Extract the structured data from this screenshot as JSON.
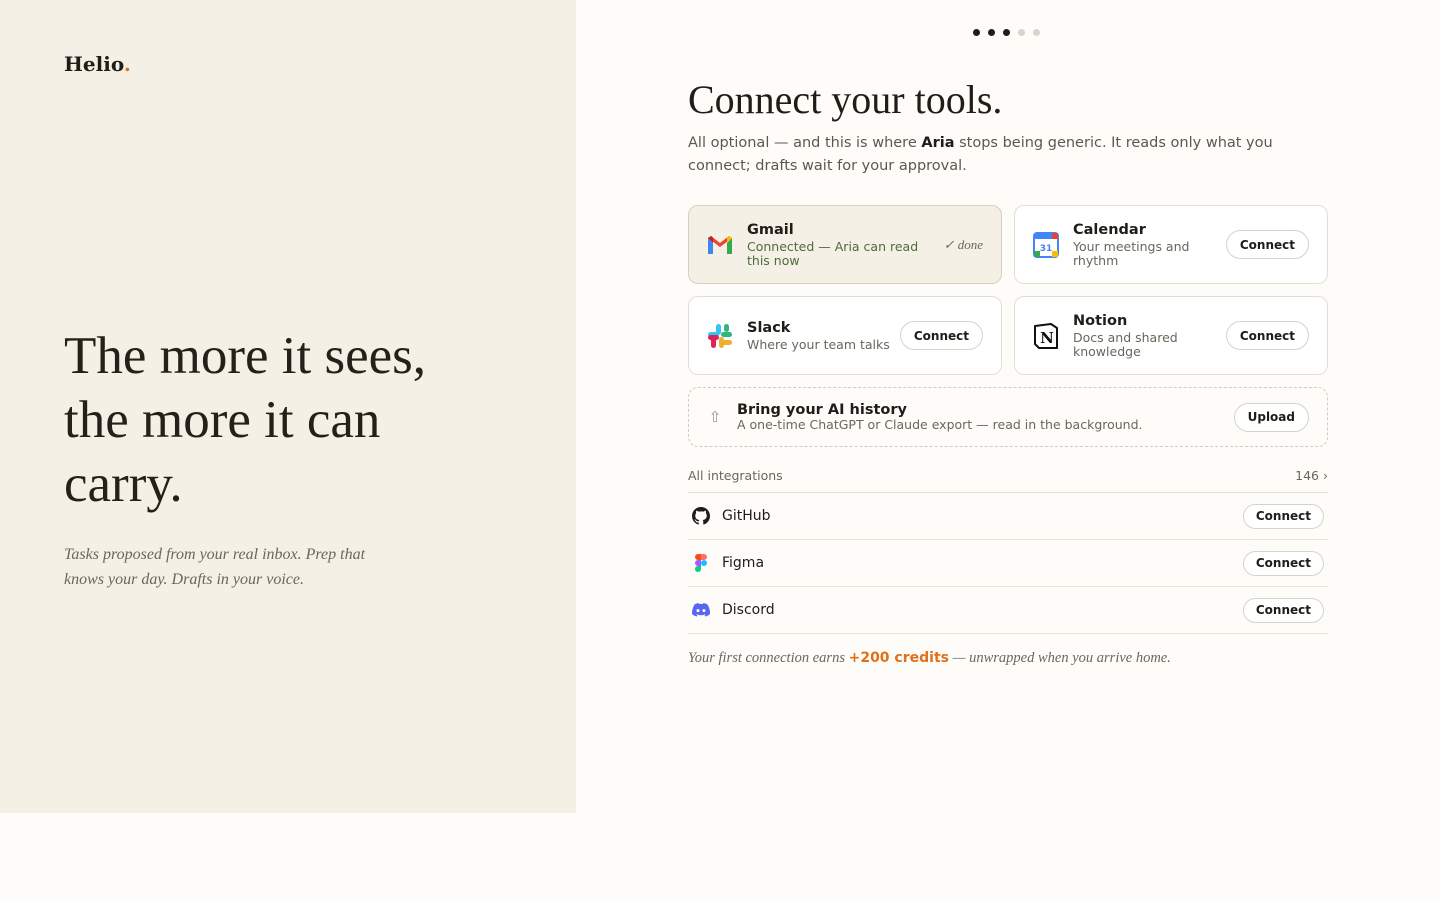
{
  "brand": {
    "name": "Helio",
    "dot": "."
  },
  "left": {
    "headline": "The more it sees, the more it can carry.",
    "lead": "Tasks proposed from your real inbox. Prep that knows your day. Drafts in your voice."
  },
  "progress": {
    "total": 5,
    "completed": 3
  },
  "main": {
    "title": "Connect your tools.",
    "subtitle_pre": "All optional — and this is where ",
    "subtitle_name": "Aria",
    "subtitle_post": " stops being generic. It reads only what you connect; drafts wait for your approval."
  },
  "cards": [
    {
      "name": "Gmail",
      "desc": "Connected — Aria can read this now",
      "status": "✓ done",
      "icon": "gmail-icon"
    },
    {
      "name": "Calendar",
      "desc": "Your meetings and rhythm",
      "button": "Connect",
      "icon": "calendar-icon",
      "calendar_day": "31"
    },
    {
      "name": "Slack",
      "desc": "Where your team talks",
      "button": "Connect",
      "icon": "slack-icon"
    },
    {
      "name": "Notion",
      "desc": "Docs and shared knowledge",
      "button": "Connect",
      "icon": "notion-icon",
      "notion_letter": "N"
    }
  ],
  "upload": {
    "name": "Bring your AI history",
    "desc": "A one-time ChatGPT or Claude export — read in the background.",
    "button": "Upload",
    "icon": "upload-icon",
    "glyph": "⇧"
  },
  "integrations": {
    "label": "All integrations",
    "count": "146 ›",
    "items": [
      {
        "name": "GitHub",
        "button": "Connect",
        "icon": "github-icon"
      },
      {
        "name": "Figma",
        "button": "Connect",
        "icon": "figma-icon"
      },
      {
        "name": "Discord",
        "button": "Connect",
        "icon": "discord-icon"
      }
    ]
  },
  "footnote": {
    "pre": "Your first connection earns ",
    "credits": "+200 credits",
    "post": " — unwrapped when you arrive home."
  },
  "colors": {
    "accent": "#e0701b",
    "panel": "#f4f0e5",
    "background": "#fdfcf8"
  }
}
